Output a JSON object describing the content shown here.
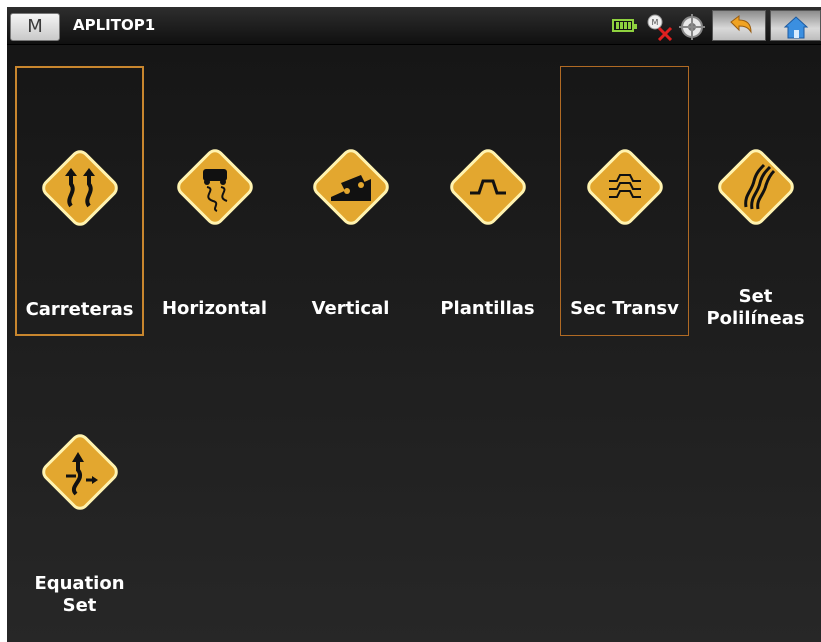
{
  "menu_button": "M",
  "title": "APLITOP1",
  "tiles": [
    {
      "label": "Carreteras",
      "icon": "winding-road-arrows-icon"
    },
    {
      "label": "Horizontal",
      "icon": "car-on-curved-road-icon"
    },
    {
      "label": "Vertical",
      "icon": "truck-on-slope-icon"
    },
    {
      "label": "Plantillas",
      "icon": "template-profile-icon"
    },
    {
      "label": "Sec Transv",
      "icon": "cross-sections-icon"
    },
    {
      "label": "Set Polilíneas",
      "label_line1": "Set",
      "label_line2": "Polilíneas",
      "icon": "polylines-icon"
    },
    {
      "label": "Equation Set",
      "label_line1": "Equation",
      "label_line2": "Set",
      "icon": "station-equation-icon"
    }
  ],
  "colors": {
    "accent": "#e3a72f",
    "selection": "#c8862e",
    "background": "#1b1b1b"
  }
}
